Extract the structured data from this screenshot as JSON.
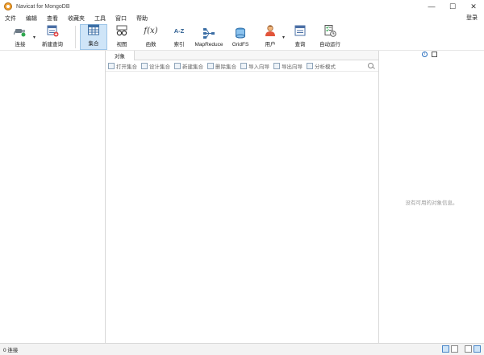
{
  "window": {
    "title": "Navicat for MongoDB"
  },
  "menubar": {
    "items": [
      "文件",
      "编辑",
      "查看",
      "收藏夹",
      "工具",
      "窗口",
      "帮助"
    ],
    "login": "登录"
  },
  "toolbar": {
    "connect": "连接",
    "new_query": "新建查询",
    "collection": "集合",
    "view": "视图",
    "function": "函数",
    "index": "索引",
    "index_icon_text": "A-Z",
    "mapreduce": "MapReduce",
    "gridfs": "GridFS",
    "user": "用户",
    "query": "查询",
    "automation": "自动运行",
    "function_icon_text": "f(x)"
  },
  "center": {
    "tab": "对象",
    "actions": [
      "打开集合",
      "设计集合",
      "新建集合",
      "删除集合",
      "导入向导",
      "导出向导",
      "分析模式"
    ]
  },
  "right_pane": {
    "empty_message": "没有可用的对象信息。",
    "info_icon_text": "i"
  },
  "statusbar": {
    "text": "0 连接"
  },
  "colors": {
    "active_tool": "#cfe5f8",
    "accent": "#2a6ebd"
  }
}
